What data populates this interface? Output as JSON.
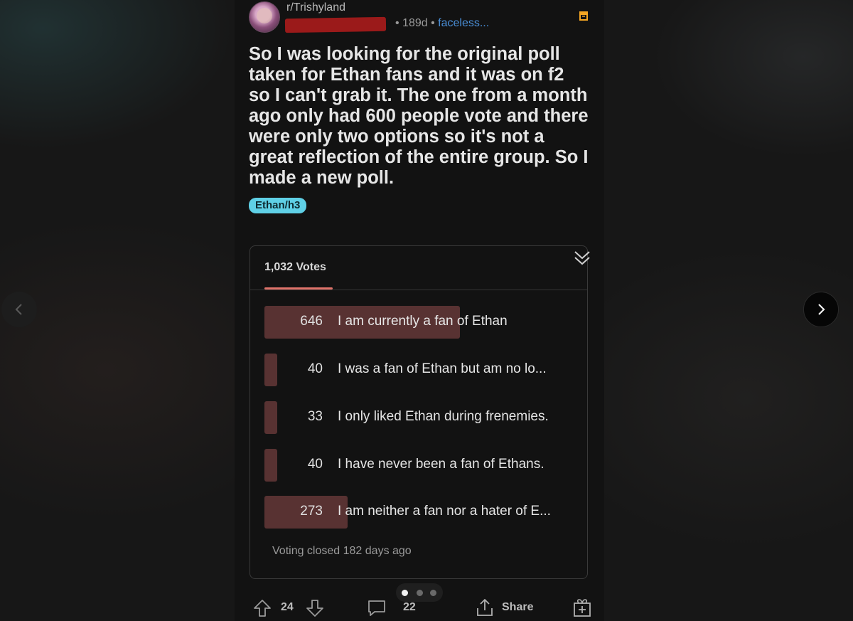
{
  "post": {
    "subreddit": "r/Trishyland",
    "age": "189d",
    "flair_link": "faceless...",
    "title": "So I was looking for the original poll taken for Ethan fans and it was on f2 so I can't grab it. The one from a month ago only had 600 people vote and there were only two options so it's not a great reflection of the entire group. So I made a new poll.",
    "tag": "Ethan/h3"
  },
  "poll": {
    "total_votes": "1,032 Votes",
    "status": "Voting closed 182 days ago",
    "options": [
      {
        "count": "646",
        "label": "I am currently a fan of Ethan",
        "share": 0.626
      },
      {
        "count": "40",
        "label": "I was a fan of Ethan but am no lo...",
        "share": 0.039
      },
      {
        "count": "33",
        "label": "I only liked Ethan during frenemies.",
        "share": 0.032
      },
      {
        "count": "40",
        "label": "I have never been a fan of Ethans.",
        "share": 0.039
      },
      {
        "count": "273",
        "label": "I am neither a fan nor a hater of E...",
        "share": 0.265
      }
    ]
  },
  "actions": {
    "upvotes": "24",
    "comments": "22",
    "share_label": "Share"
  },
  "carousel": {
    "active_index": 0,
    "total": 3
  },
  "icons": {
    "archive": "archive-icon",
    "collapse": "chevron-double-down-icon",
    "upvote": "arrow-up-icon",
    "downvote": "arrow-down-icon",
    "comment": "comment-icon",
    "share": "share-icon",
    "award": "gift-icon",
    "prev": "chevron-left-icon",
    "next": "chevron-right-icon"
  },
  "colors": {
    "archive_icon": "#f5a623",
    "tag_bg": "#5fd0e6",
    "poll_bar": "#583232",
    "poll_underline": "#e0736a",
    "flair_link": "#4a8fd8"
  }
}
